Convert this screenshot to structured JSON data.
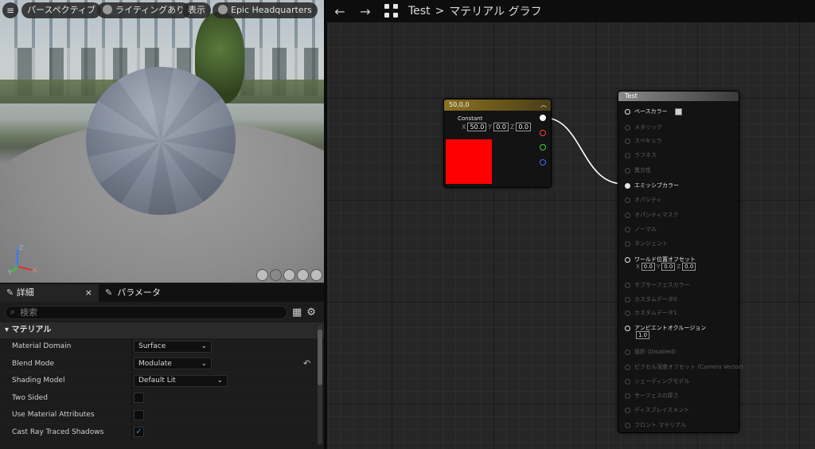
{
  "viewport": {
    "menu_icon": "≡",
    "buttons": {
      "perspective": "パースペクティブ",
      "lighting": "ライティングあり",
      "show": "表示",
      "environment": "Epic Headquarters"
    },
    "axis": {
      "z": "Z",
      "x": "X",
      "y": "Y"
    }
  },
  "details": {
    "tabs": {
      "details": "詳細",
      "details_close": "×",
      "parameters": "パラメータ"
    },
    "search": {
      "placeholder": "検索"
    },
    "section": "▾ マテリアル",
    "properties": [
      {
        "name": "Material Domain",
        "value": "Surface"
      },
      {
        "name": "Blend Mode",
        "value": "Modulate"
      },
      {
        "name": "Shading Model",
        "value": "Default Lit"
      },
      {
        "name": "Two Sided",
        "checked": false
      },
      {
        "name": "Use Material Attributes",
        "checked": false
      },
      {
        "name": "Cast Ray Traced Shadows",
        "checked": true
      }
    ],
    "reset_icon": "↶"
  },
  "graph": {
    "breadcrumb": {
      "root": "Test",
      "sep": ">",
      "current": "マテリアル グラフ"
    },
    "nav": {
      "back": "←",
      "forward": "→"
    },
    "constant_node": {
      "title": "50,0,0",
      "label": "Constant",
      "fields": [
        {
          "axis": "X",
          "value": "50.0"
        },
        {
          "axis": "Y",
          "value": "0.0"
        },
        {
          "axis": "Z",
          "value": "0.0"
        }
      ],
      "color": "#ff0000",
      "pins": [
        "#ffffff",
        "#ff3b3b",
        "#3bd13b",
        "#3b6bff"
      ]
    },
    "result_node": {
      "title": "Test",
      "pins": [
        {
          "label": "ベースカラー",
          "active": true
        },
        {
          "label": "メタリック",
          "active": false
        },
        {
          "label": "スペキュラ",
          "active": false
        },
        {
          "label": "ラフネス",
          "active": false
        },
        {
          "label": "異方性",
          "active": false
        },
        {
          "label": "エミッシブカラー",
          "active": true,
          "connected": true
        },
        {
          "label": "オパシティ",
          "active": false
        },
        {
          "label": "オパシティマスク",
          "active": false
        },
        {
          "label": "ノーマル",
          "active": false
        },
        {
          "label": "タンジェント",
          "active": false
        },
        {
          "label": "ワールド位置オフセット",
          "active": true
        },
        {
          "label": "サブサーフェスカラー",
          "active": false
        },
        {
          "label": "カスタムデータ0",
          "active": false
        },
        {
          "label": "カスタムデータ1",
          "active": false
        },
        {
          "label": "アンビエントオクルージョン",
          "active": true
        },
        {
          "label": "屈折 (Disabled)",
          "active": false
        },
        {
          "label": "ピクセル深度オフセット (Camera Vector)",
          "active": false
        },
        {
          "label": "シェーディングモデル",
          "active": false
        },
        {
          "label": "サーフェスの厚さ",
          "active": false
        },
        {
          "label": "ディスプレイスメント",
          "active": false
        },
        {
          "label": "フロント マテリアル",
          "active": false
        }
      ],
      "wpo": [
        {
          "axis": "X",
          "value": "0.0"
        },
        {
          "axis": "Y",
          "value": "0.0"
        },
        {
          "axis": "Z",
          "value": "0.0"
        }
      ],
      "ao_value": "1.0"
    },
    "wire_color": "#ffffff"
  }
}
